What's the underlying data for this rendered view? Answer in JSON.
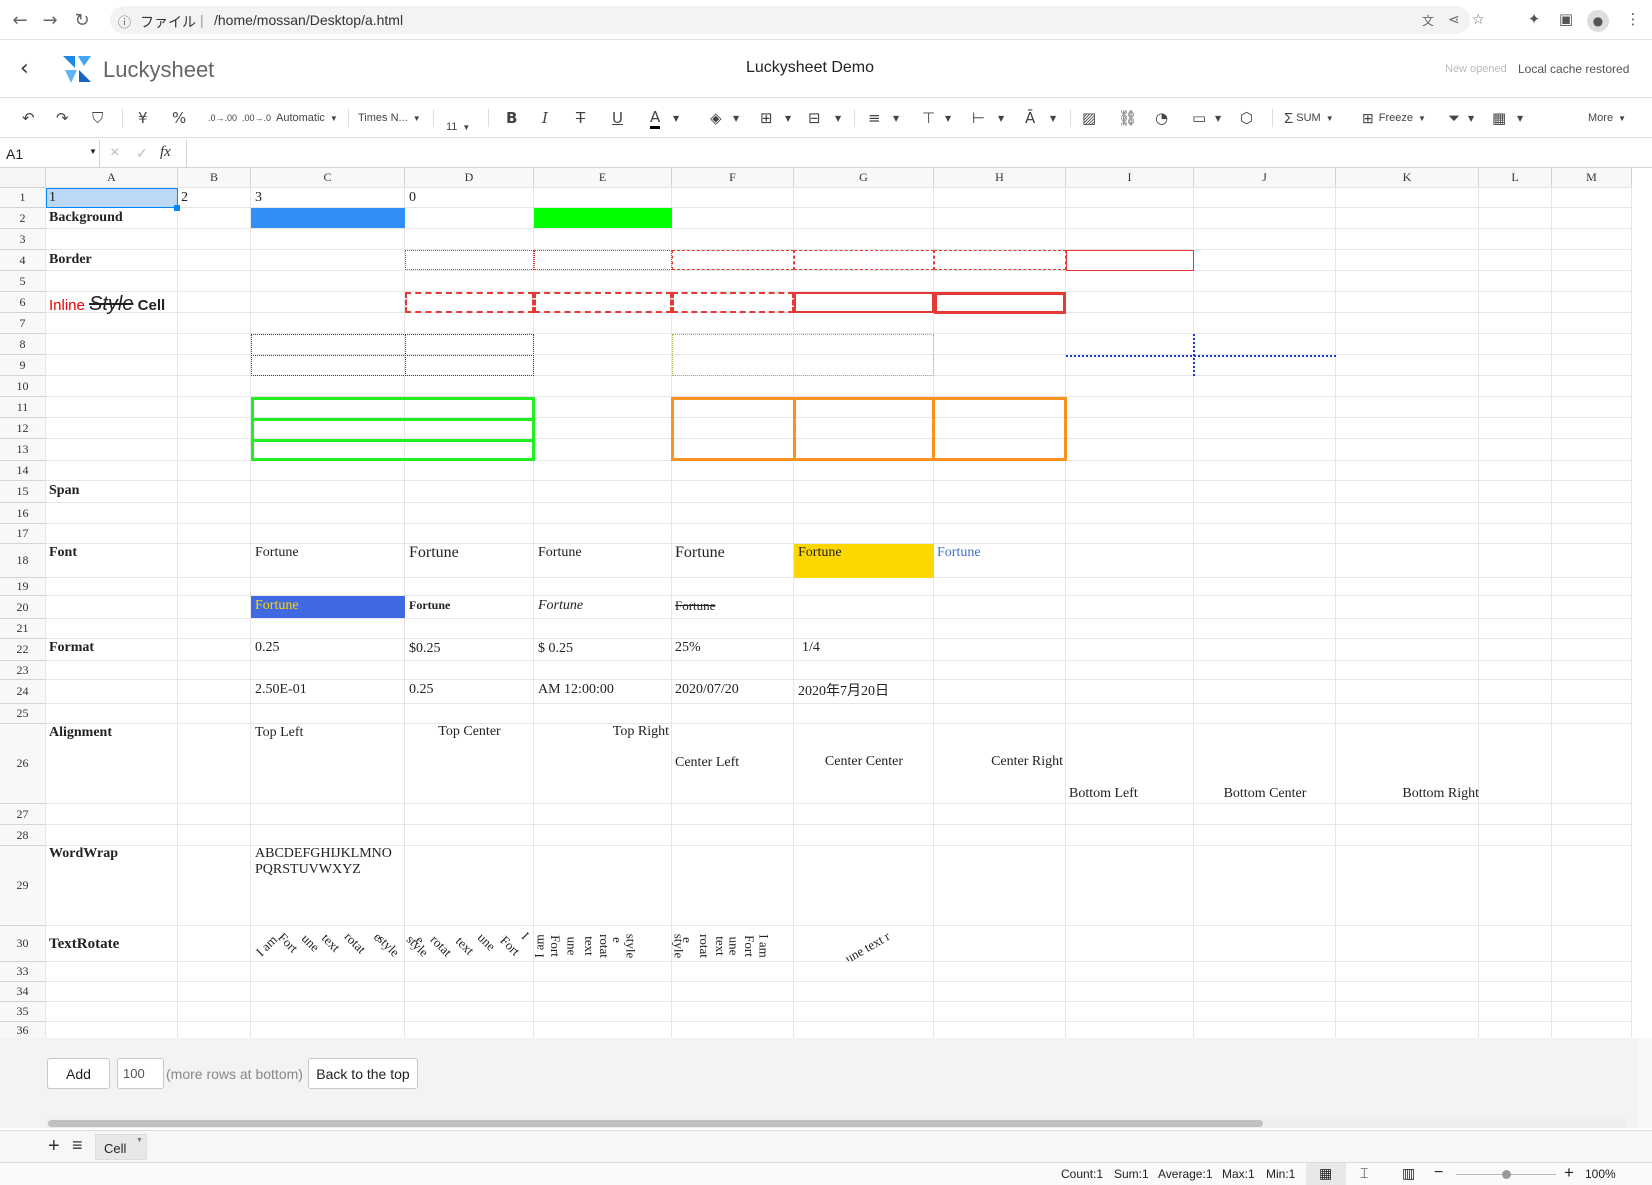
{
  "browser": {
    "page_info": "ファイル",
    "url": "/home/mossan/Desktop/a.html"
  },
  "app": {
    "logo": "Luckysheet",
    "title": "Luckysheet Demo",
    "status_new": "New opened",
    "status_cache": "Local cache restored"
  },
  "toolbar": {
    "format": "Automatic",
    "font": "Times N...",
    "size": "11",
    "currency": "¥",
    "percent": "%",
    "sum": "SUM",
    "freeze": "Freeze",
    "more": "More",
    "dec_add": ".0→.00",
    "dec_sub": ".00→.0"
  },
  "formula": {
    "cell_ref": "A1",
    "fx": "fx",
    "cancel": "×",
    "confirm": "✓"
  },
  "columns": [
    "A",
    "B",
    "C",
    "D",
    "E",
    "F",
    "G",
    "H",
    "I",
    "J",
    "K",
    "L",
    "M"
  ],
  "rows": [
    "1",
    "2",
    "3",
    "4",
    "5",
    "6",
    "7",
    "8",
    "9",
    "10",
    "11",
    "12",
    "13",
    "14",
    "15",
    "16",
    "17",
    "18",
    "19",
    "20",
    "21",
    "22",
    "23",
    "24",
    "25",
    "26",
    "27",
    "28",
    "29",
    "30",
    "33",
    "34",
    "35",
    "36"
  ],
  "cells": {
    "a1": "1",
    "b1": "2",
    "c1": "3",
    "d1": "0",
    "background": "Background",
    "border": "Border",
    "inline_1": "Inline",
    "inline_2": "Style",
    "inline_3": "Cell",
    "span": "Span",
    "font": "Font",
    "fortune": "Fortune",
    "format": "Format",
    "f_c22": "0.25",
    "f_d22": "$0.25",
    "f_e22": "$ 0.25",
    "f_f22": "25%",
    "f_g22": "1/4",
    "f_c24": "2.50E-01",
    "f_d24": "0.25",
    "f_e24": "AM 12:00:00",
    "f_f24": "2020/07/20",
    "f_g24": "2020年7月20日",
    "alignment": "Alignment",
    "top_left": "Top Left",
    "top_center": "Top Center",
    "top_right": "Top Right",
    "center_left": "Center Left",
    "center_center": "Center Center",
    "center_right": "Center Right",
    "bottom_left": "Bottom Left",
    "bottom_center": "Bottom Center",
    "bottom_right": "Bottom Right",
    "wordwrap": "WordWrap",
    "wrap_1": "ABCDEFGHIJKLMNO",
    "wrap_2": "PQRSTUVWXYZ",
    "textrotate": "TextRotate",
    "rot_c": [
      "I am",
      "Fort",
      "une",
      "text",
      "rotat",
      "e",
      "style"
    ],
    "rot_d": [
      "style",
      "e",
      "rotat",
      "text",
      "une",
      "Fort",
      "I"
    ],
    "rot_e": [
      "I am",
      "Fort",
      "une",
      "text",
      "rotat",
      "e",
      "style"
    ],
    "rot_f": [
      "style",
      "e",
      "rotat",
      "text",
      "une",
      "Fort",
      "I am"
    ],
    "rot_g": "...une text r"
  },
  "bottom": {
    "add": "Add",
    "rows_value": "100",
    "rows_hint": "(more rows at bottom)",
    "back_top": "Back to the top"
  },
  "sheet": {
    "tab": "Cell"
  },
  "status": {
    "count": "Count:1",
    "sum": "Sum:1",
    "average": "Average:1",
    "max": "Max:1",
    "min": "Min:1",
    "zoom": "100%"
  },
  "colors": {
    "blue_fill": "#2f8ff5",
    "green_fill": "#00ff00",
    "gold_fill": "#ffd700",
    "royal_fill": "#4169e1",
    "selection": "#bcd8f5",
    "accent": "#0188fb"
  }
}
